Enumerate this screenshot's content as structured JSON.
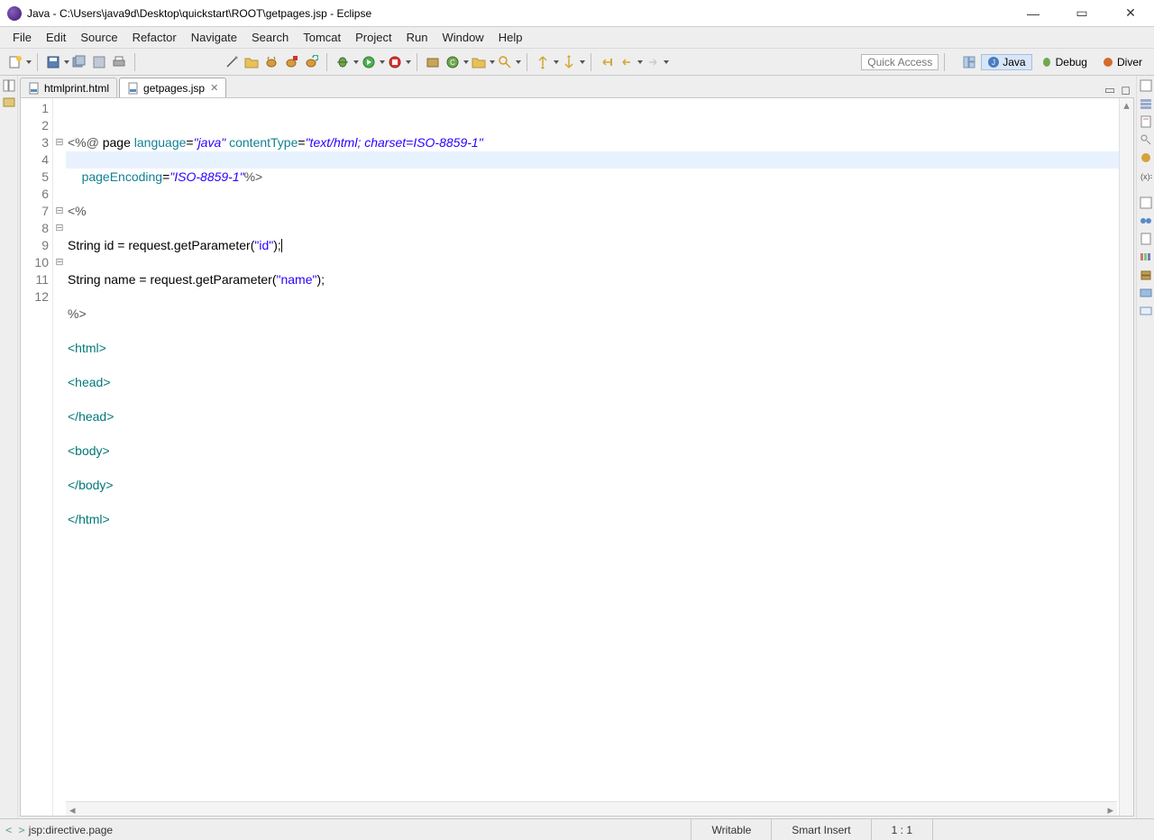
{
  "window": {
    "title": "Java - C:\\Users\\java9d\\Desktop\\quickstart\\ROOT\\getpages.jsp - Eclipse"
  },
  "menu": {
    "file": "File",
    "edit": "Edit",
    "source": "Source",
    "refactor": "Refactor",
    "navigate": "Navigate",
    "search": "Search",
    "tomcat": "Tomcat",
    "project": "Project",
    "run": "Run",
    "window": "Window",
    "help": "Help"
  },
  "toolbar": {
    "quick_access_placeholder": "Quick Access"
  },
  "perspectives": {
    "java": "Java",
    "debug": "Debug",
    "diver": "Diver"
  },
  "tabs": {
    "htmlprint": "htmlprint.html",
    "getpages": "getpages.jsp"
  },
  "code": {
    "l1_a": "<%@",
    "l1_b": " page ",
    "l1_c": "language",
    "l1_d": "=",
    "l1_e": "\"java\"",
    "l1_f": " contentType",
    "l1_g": "=",
    "l1_h": "\"text/html; charset=ISO-8859-1\"",
    "l2_a": "    ",
    "l2_b": "pageEncoding",
    "l2_c": "=",
    "l2_d": "\"ISO-8859-1\"",
    "l2_e": "%>",
    "l3": "<%",
    "l4_a": "String id = request.getParameter(",
    "l4_b": "\"id\"",
    "l4_c": ");",
    "l5_a": "String name = request.getParameter(",
    "l5_b": "\"name\"",
    "l5_c": ");",
    "l6": "%>",
    "l7": "<html>",
    "l8": "<head>",
    "l9": "</head>",
    "l10": "<body>",
    "l11": "</body>",
    "l12": "</html>"
  },
  "linenums": {
    "n1": "1",
    "n2": "2",
    "n3": "3",
    "n4": "4",
    "n5": "5",
    "n6": "6",
    "n7": "7",
    "n8": "8",
    "n9": "9",
    "n10": "10",
    "n11": "11",
    "n12": "12"
  },
  "status": {
    "breadcrumb": "jsp:directive.page",
    "writable": "Writable",
    "insert": "Smart Insert",
    "pos": "1 : 1"
  }
}
